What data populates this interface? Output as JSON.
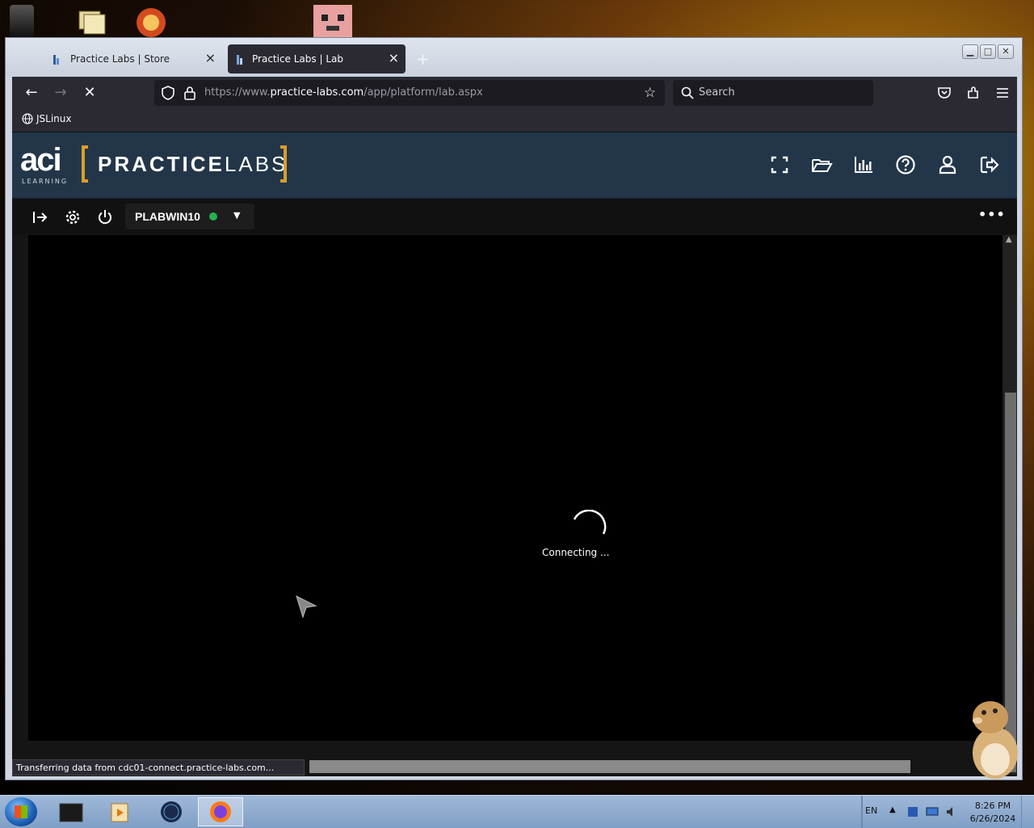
{
  "browser": {
    "tabs": [
      {
        "title": "Practice Labs | Store",
        "active": false
      },
      {
        "title": "Practice Labs | Lab",
        "active": true
      }
    ],
    "url": {
      "prefix": "https://www.",
      "host": "practice-labs.com",
      "path": "/app/platform/lab.aspx"
    },
    "search_placeholder": "Search",
    "bookmarks": [
      {
        "label": "JSLinux"
      }
    ],
    "status_text": "Transferring data from cdc01-connect.practice-labs.com..."
  },
  "practicelabs": {
    "logo_aci": "aci",
    "logo_aci_sub": "LEARNING",
    "logo_bold": "PRACTICE",
    "logo_light": "LABS",
    "accent_color": "#d99e2b",
    "header_color": "#233649"
  },
  "lab": {
    "machine_name": "PLABWIN10",
    "machine_status": "online",
    "status_color": "#22b14c",
    "console_message": "Connecting ..."
  },
  "taskbar": {
    "language": "EN",
    "time": "8:26 PM",
    "date": "6/26/2024"
  }
}
